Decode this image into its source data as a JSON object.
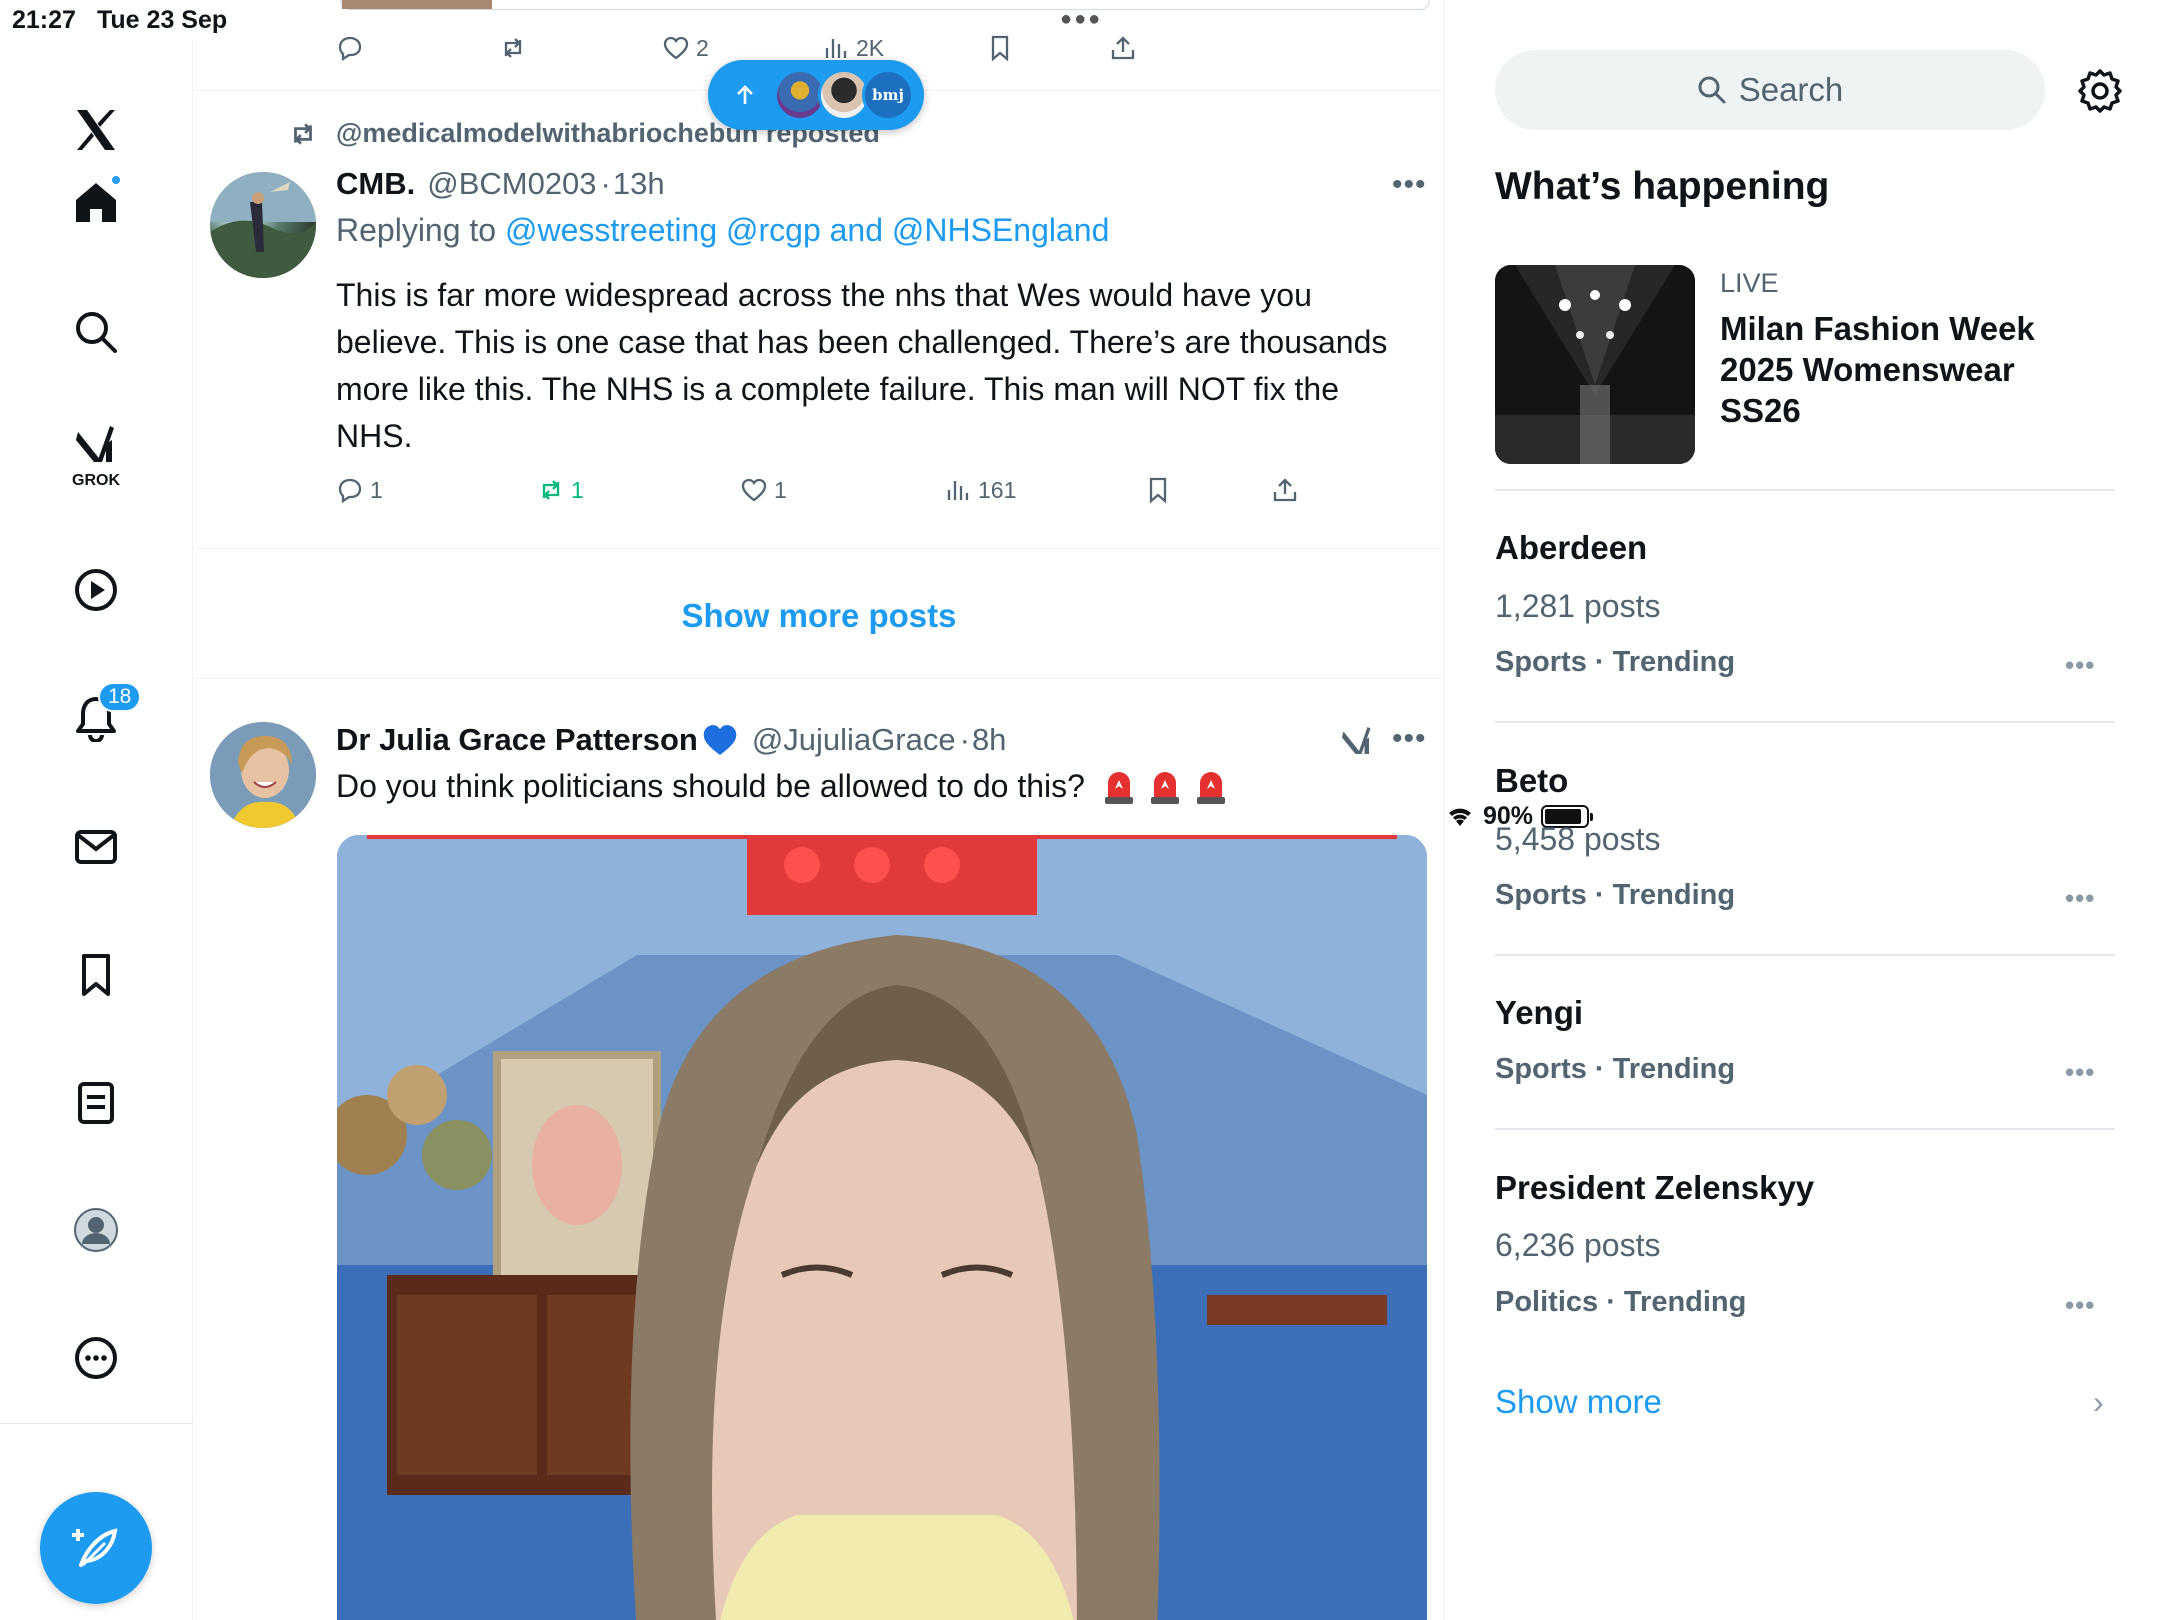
{
  "status_bar": {
    "time": "21:27",
    "date": "Tue 23 Sep",
    "battery": "90%"
  },
  "nav": {
    "notifications_badge": "18",
    "grok_label": "GROK"
  },
  "feed": {
    "prev_tweet": {
      "likes": "2",
      "views": "2K"
    },
    "repost_by": "@medicalmodelwithabriochebun reposted",
    "tweet1": {
      "name": "CMB.",
      "handle": "@BCM0203",
      "sep": "·",
      "time": "13h",
      "replying_prefix": "Replying to ",
      "reply_handle_1": "@wesstreeting",
      "reply_handle_2": "@rcgp",
      "reply_and": "and",
      "reply_handle_3": "@NHSEngland",
      "text": "This is far more widespread across the nhs that Wes would have you believe. This is one case that has been challenged. There’s are thousands more like this. The NHS is a complete failure. This man will NOT fix the NHS.",
      "replies": "1",
      "reposts": "1",
      "likes": "1",
      "views": "161"
    },
    "show_more_posts": "Show more posts",
    "tweet2": {
      "name": "Dr Julia Grace Patterson",
      "handle": "@JujuliaGrace",
      "sep": "·",
      "time": "8h",
      "text": "Do you think politicians should be allowed to do this?"
    },
    "new_posts_pill_label": "bmj"
  },
  "sidebar": {
    "search_placeholder": "Search",
    "section_title": "What’s happening",
    "live": {
      "label": "LIVE",
      "title": "Milan Fashion Week 2025 Womenswear SS26"
    },
    "trends": [
      {
        "title": "Aberdeen",
        "count": "1,281 posts",
        "meta": "Sports · Trending"
      },
      {
        "title": "Beto",
        "count": "5,458 posts",
        "meta": "Sports · Trending"
      },
      {
        "title": "Yengi",
        "count": "",
        "meta": "Sports · Trending"
      },
      {
        "title": "President Zelenskyy",
        "count": "6,236 posts",
        "meta": "Politics · Trending"
      }
    ],
    "show_more": "Show more"
  },
  "colors": {
    "accent": "#1d9bf0",
    "repost_green": "#00ba7c",
    "muted": "#536471"
  }
}
